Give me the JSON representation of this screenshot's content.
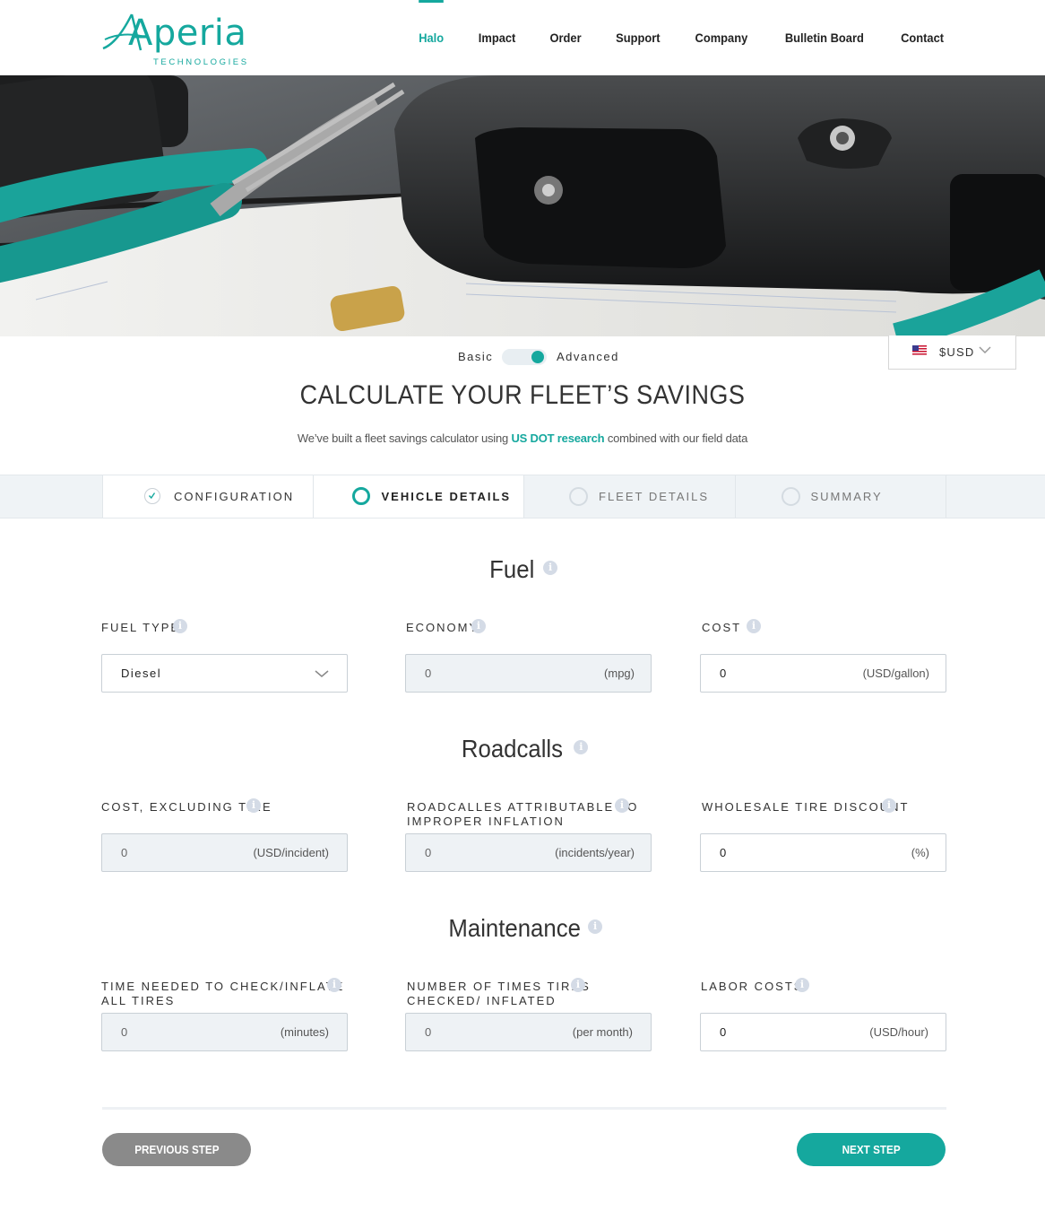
{
  "brand": {
    "logo_word": "Aperia",
    "logo_sub": "TECHNOLOGIES",
    "accent_color": "#15a89e"
  },
  "nav": {
    "items": [
      "Halo",
      "Impact",
      "Order",
      "Support",
      "Company",
      "Bulletin Board",
      "Contact"
    ],
    "active": "Halo"
  },
  "mode": {
    "basic_label": "Basic",
    "advanced_label": "Advanced",
    "selected": "Advanced"
  },
  "currency": {
    "label": "$USD",
    "flag_icon": "us-flag-icon"
  },
  "header": {
    "title": "CALCULATE YOUR FLEET’S SAVINGS",
    "subtitle_before": "We’ve built a fleet savings calculator using",
    "subtitle_link": "US DOT research",
    "subtitle_after": "combined with our field data"
  },
  "steps": [
    {
      "label": "CONFIGURATION",
      "state": "done"
    },
    {
      "label": "VEHICLE DETAILS",
      "state": "active"
    },
    {
      "label": "FLEET DETAILS",
      "state": "pending"
    },
    {
      "label": "SUMMARY",
      "state": "pending"
    }
  ],
  "sections": {
    "fuel": {
      "title": "Fuel",
      "fuel_type": {
        "label": "FUEL TYPE",
        "value": "Diesel"
      },
      "economy": {
        "label": "ECONOMY",
        "value": "0",
        "unit": "(mpg)"
      },
      "cost": {
        "label": "COST",
        "value": "0",
        "unit": "(USD/gallon)"
      }
    },
    "roadcalls": {
      "title": "Roadcalls",
      "cost_excluding_tire": {
        "label": "COST, EXCLUDING TIRE",
        "value": "0",
        "unit": "(USD/incident)"
      },
      "attributable": {
        "label_line1": "ROADCALLES ATTRIBUTABLE TO",
        "label_line2": "IMPROPER INFLATION",
        "value": "0",
        "unit": "(incidents/year)"
      },
      "wholesale_discount": {
        "label": "WHOLESALE TIRE DISCOUNT",
        "value": "0",
        "unit": "(%)"
      }
    },
    "maintenance": {
      "title": "Maintenance",
      "time_needed": {
        "label_line1": "TIME NEEDED TO CHECK/INFLATE",
        "label_line2": "ALL TIRES",
        "value": "0",
        "unit": "(minutes)"
      },
      "times_checked": {
        "label_line1": "NUMBER OF TIMES TIRES",
        "label_line2": "CHECKED/ INFLATED",
        "value": "0",
        "unit": "(per month)"
      },
      "labor_costs": {
        "label": "LABOR COSTS",
        "value": "0",
        "unit": "(USD/hour)"
      }
    }
  },
  "buttons": {
    "previous": "PREVIOUS STEP",
    "next": "NEXT STEP"
  },
  "info_glyph": "i"
}
